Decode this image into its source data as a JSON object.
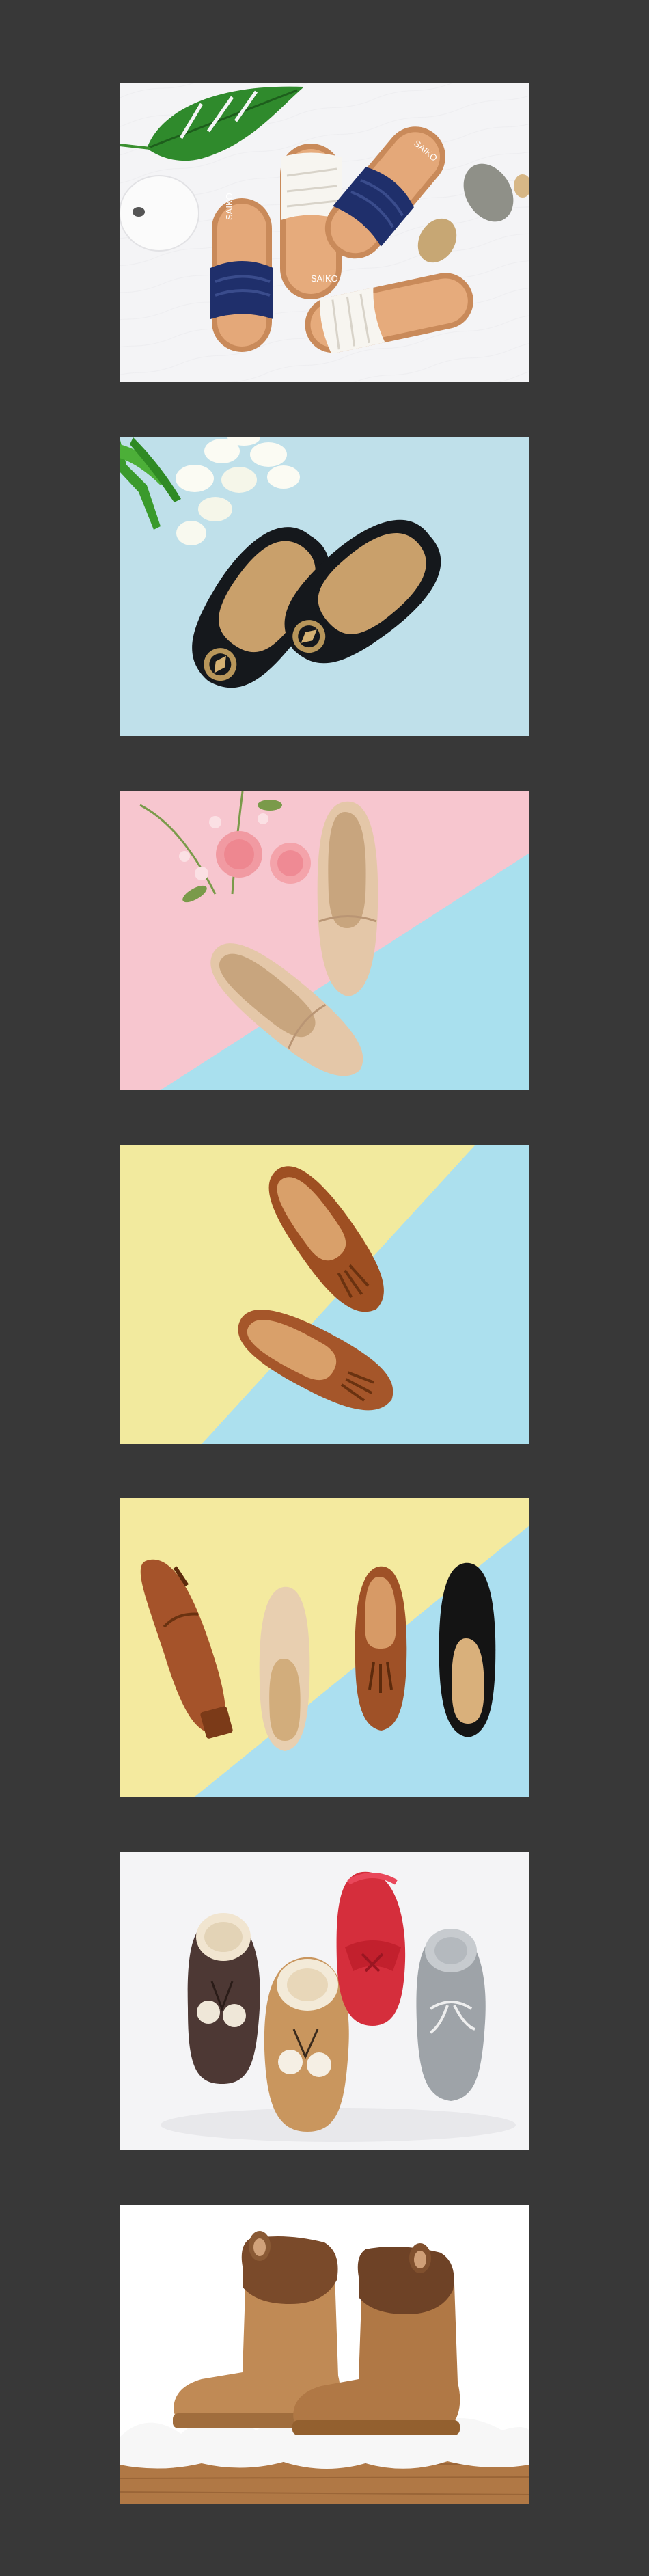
{
  "gallery": {
    "background": "#383838",
    "photos": [
      {
        "id": "slides",
        "background": "#f4f4f6",
        "shoe_colors": [
          "#c98a5a",
          "#1f2f6b",
          "#f7f5f0"
        ],
        "logo_texts": [
          "SAIKO",
          "SAIKO",
          "SAIKO"
        ]
      },
      {
        "id": "black-flats",
        "background": "#bfe0ea",
        "shoe_colors": [
          "#15181c",
          "#c9a06b",
          "#b8965a"
        ]
      },
      {
        "id": "beige-loafers",
        "background_colors": [
          "#f7c6cf",
          "#a9e0ee"
        ],
        "shoe_colors": [
          "#e4c7a8",
          "#c8a57e"
        ]
      },
      {
        "id": "brown-tassel-loafers",
        "background_colors": [
          "#f2ea9e",
          "#ace0ee"
        ],
        "shoe_colors": [
          "#9e4f22",
          "#d9a06a"
        ]
      },
      {
        "id": "four-loafers",
        "background_colors": [
          "#f4ea9f",
          "#abdff0"
        ],
        "shoe_colors": [
          "#a5532a",
          "#e8cfb0",
          "#9f5127",
          "#141414"
        ]
      },
      {
        "id": "fur-winter-shoes",
        "background": "#f4f4f6",
        "shoe_colors": [
          "#4d3834",
          "#c9965e",
          "#d52e3c",
          "#9ea3a8"
        ]
      },
      {
        "id": "fur-boots",
        "background": "#ffffff",
        "shoe_colors": [
          "#c08a55",
          "#7a4a2a",
          "#b07845"
        ]
      }
    ]
  }
}
